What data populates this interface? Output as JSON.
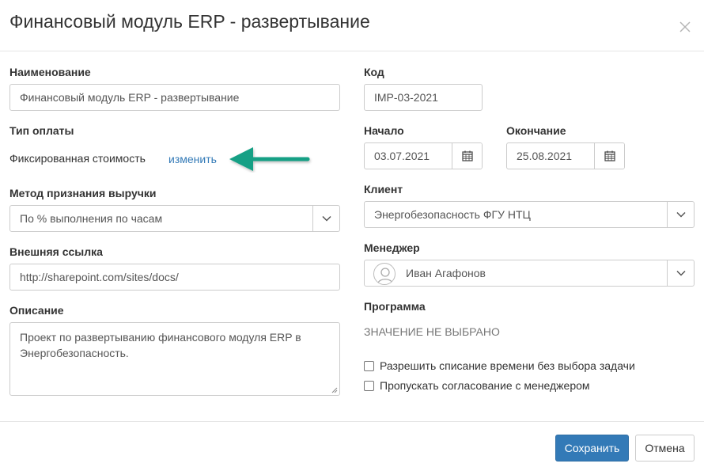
{
  "dialog": {
    "title": "Финансовый модуль ERP - развертывание"
  },
  "left": {
    "name_label": "Наименование",
    "name_value": "Финансовый модуль ERP - развертывание",
    "payment_type_label": "Тип оплаты",
    "payment_type_value": "Фиксированная стоимость",
    "payment_type_change_link": "изменить",
    "revenue_method_label": "Метод признания выручки",
    "revenue_method_value": "По % выполнения по часам",
    "external_link_label": "Внешняя ссылка",
    "external_link_value": "http://sharepoint.com/sites/docs/",
    "description_label": "Описание",
    "description_value": "Проект по развертыванию финансового модуля ERP в Энергобезопасность."
  },
  "right": {
    "code_label": "Код",
    "code_value": "IMP-03-2021",
    "start_label": "Начало",
    "start_value": "03.07.2021",
    "end_label": "Окончание",
    "end_value": "25.08.2021",
    "client_label": "Клиент",
    "client_value": "Энергобезопасность ФГУ НТЦ",
    "manager_label": "Менеджер",
    "manager_value": "Иван Агафонов",
    "program_label": "Программа",
    "program_value": "ЗНАЧЕНИЕ НЕ ВЫБРАНО",
    "checkbox_allow_time": {
      "label": "Разрешить списание времени без выбора задачи",
      "checked": false
    },
    "checkbox_skip_approval": {
      "label": "Пропускать согласование с менеджером",
      "checked": false
    }
  },
  "footer": {
    "save_label": "Сохранить",
    "cancel_label": "Отмена"
  },
  "colors": {
    "primary": "#337ab7",
    "link": "#337ab7",
    "annotation_arrow": "#14a085"
  },
  "icons": {
    "close": "close-icon",
    "calendar": "calendar-icon",
    "chevron": "chevron-down-icon",
    "avatar": "user-avatar-icon",
    "annotation": "arrow-left-icon"
  }
}
